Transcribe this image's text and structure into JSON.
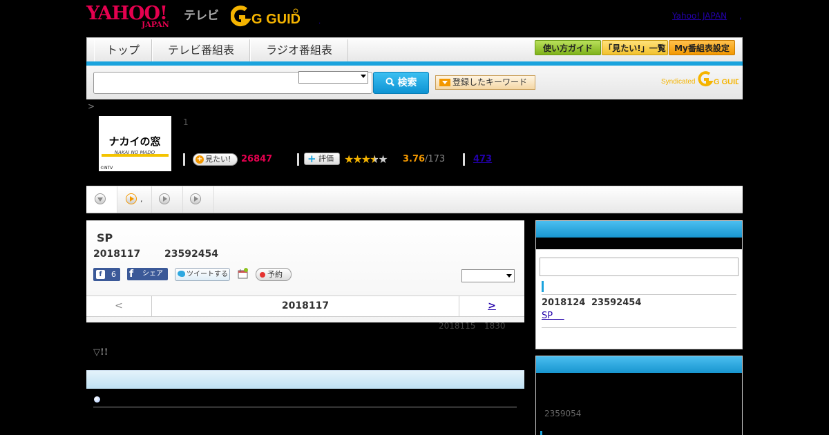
{
  "header": {
    "yahoo_logo": "YAHOO!",
    "yahoo_logo_sub": "JAPAN",
    "tv_label": "テレビ",
    "gguide_logo": "G GUIDE",
    "yahoo_japan_link": "Yahoo! JAPAN",
    "comma": ",",
    "dot": "."
  },
  "nav": {
    "tabs": [
      "トップ",
      "テレビ番組表",
      "ラジオ番組表"
    ],
    "buttons": [
      {
        "label": "使い方ガイド",
        "bg": "#8dc21f"
      },
      {
        "label": "「見たい!」一覧",
        "bg": "#f4c430"
      },
      {
        "label": "My番組表設定",
        "bg": "#f39800"
      }
    ]
  },
  "search": {
    "placeholder": "",
    "select_value": "",
    "search_button": "検索",
    "keyword_button": "登録したキーワード",
    "syndicated_label": "Syndicated",
    "syndicated_logo": "G GUIDE"
  },
  "breadcrumb": {
    "separator": ">"
  },
  "program": {
    "logo_text": "ナカイの窓",
    "logo_sub": "NAKAI NO MADO",
    "logo_credit": "©NTV",
    "number": "1",
    "want_label": "見たい!",
    "want_count": "26847",
    "rating_label": "評価",
    "rating_score": "3.76",
    "rating_total": "/173",
    "comment_count": "473"
  },
  "tabs": {
    "second_label": ","
  },
  "episode": {
    "title": "SP",
    "date": "2018117",
    "time": "23592454",
    "fb_like_count": "6",
    "fb_share_label": "シェア",
    "tweet_label": "ツイートする",
    "reserve_label": "予約",
    "channel_select": "",
    "prev": "<",
    "nav_date": "2018117",
    "next": ">"
  },
  "update": {
    "date": "2018115",
    "time": "1830"
  },
  "intro": {
    "text": "▽!!"
  },
  "sidebar": {
    "next_date": "2018124",
    "next_time": "23592454",
    "next_link": "SP",
    "code": "2359054"
  },
  "colors": {
    "accent_blue": "#1aa3dd",
    "brand_red": "#e5004f",
    "rating_orange": "#f39800",
    "link": "#2200aa"
  }
}
